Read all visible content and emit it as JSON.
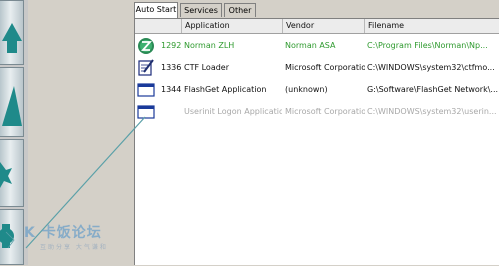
{
  "tabs": [
    {
      "label": "Auto Start",
      "active": true
    },
    {
      "label": "Services",
      "active": false
    },
    {
      "label": "Other",
      "active": false
    }
  ],
  "table": {
    "columns": [
      "Application",
      "Vendor",
      "Filename"
    ],
    "rows": [
      {
        "pid": "1292",
        "application": "Norman ZLH",
        "vendor": "Norman ASA",
        "filename": "C:\\Program Files\\Norman\\Np...",
        "icon": "norman-z-icon",
        "style": "green"
      },
      {
        "pid": "1336",
        "application": "CTF Loader",
        "vendor": "Microsoft Corporation",
        "filename": "C:\\WINDOWS\\system32\\ctfmo...",
        "icon": "notepad-pen-icon",
        "style": "normal"
      },
      {
        "pid": "1344",
        "application": "FlashGet Application",
        "vendor": "(unknown)",
        "filename": "G:\\Software\\FlashGet Network\\...",
        "icon": "application-window-icon",
        "style": "normal"
      },
      {
        "pid": "",
        "application": "Userinit Logon Application",
        "vendor": "Microsoft Corporation",
        "filename": "C:\\WINDOWS\\system32\\userin...",
        "icon": "application-window-icon",
        "style": "faded"
      }
    ]
  },
  "watermark": {
    "main": "K 卡饭论坛",
    "sub": "互助分享 大气谦和"
  },
  "colors": {
    "green_text": "#2e9a2e",
    "faded_text": "#a8a8a8",
    "side_button_teal": "#1f8a8a",
    "connector": "#5aa0a8"
  }
}
